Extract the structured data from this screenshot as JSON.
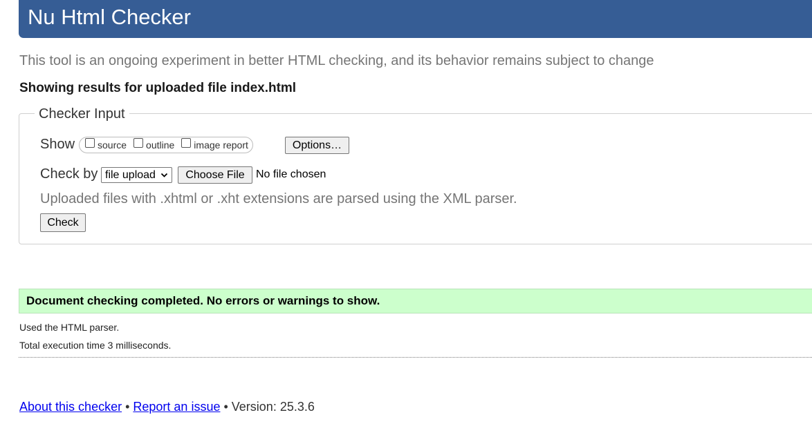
{
  "header": {
    "title": "Nu Html Checker"
  },
  "tagline": "This tool is an ongoing experiment in better HTML checking, and its behavior remains subject to change",
  "results_heading": "Showing results for uploaded file index.html",
  "checker_input": {
    "legend": "Checker Input",
    "show_label": "Show",
    "show_options": [
      {
        "label": "source",
        "checked": false
      },
      {
        "label": "outline",
        "checked": false
      },
      {
        "label": "image report",
        "checked": false
      }
    ],
    "options_button": "Options…",
    "check_by_label": "Check by",
    "check_by_selected": "file upload",
    "choose_file_button": "Choose File",
    "file_status": "No file chosen",
    "note": "Uploaded files with .xhtml or .xht extensions are parsed using the XML parser.",
    "check_button": "Check"
  },
  "result": {
    "success_message": "Document checking completed. No errors or warnings to show.",
    "parser_info": "Used the HTML parser.",
    "execution_time": "Total execution time 3 milliseconds."
  },
  "footer": {
    "about_link": "About this checker",
    "separator": " • ",
    "report_link": "Report an issue",
    "version": "Version: 25.3.6"
  },
  "colors": {
    "header_bg": "#365d95",
    "success_bg": "#ccffcc",
    "link": "#0000ee"
  }
}
